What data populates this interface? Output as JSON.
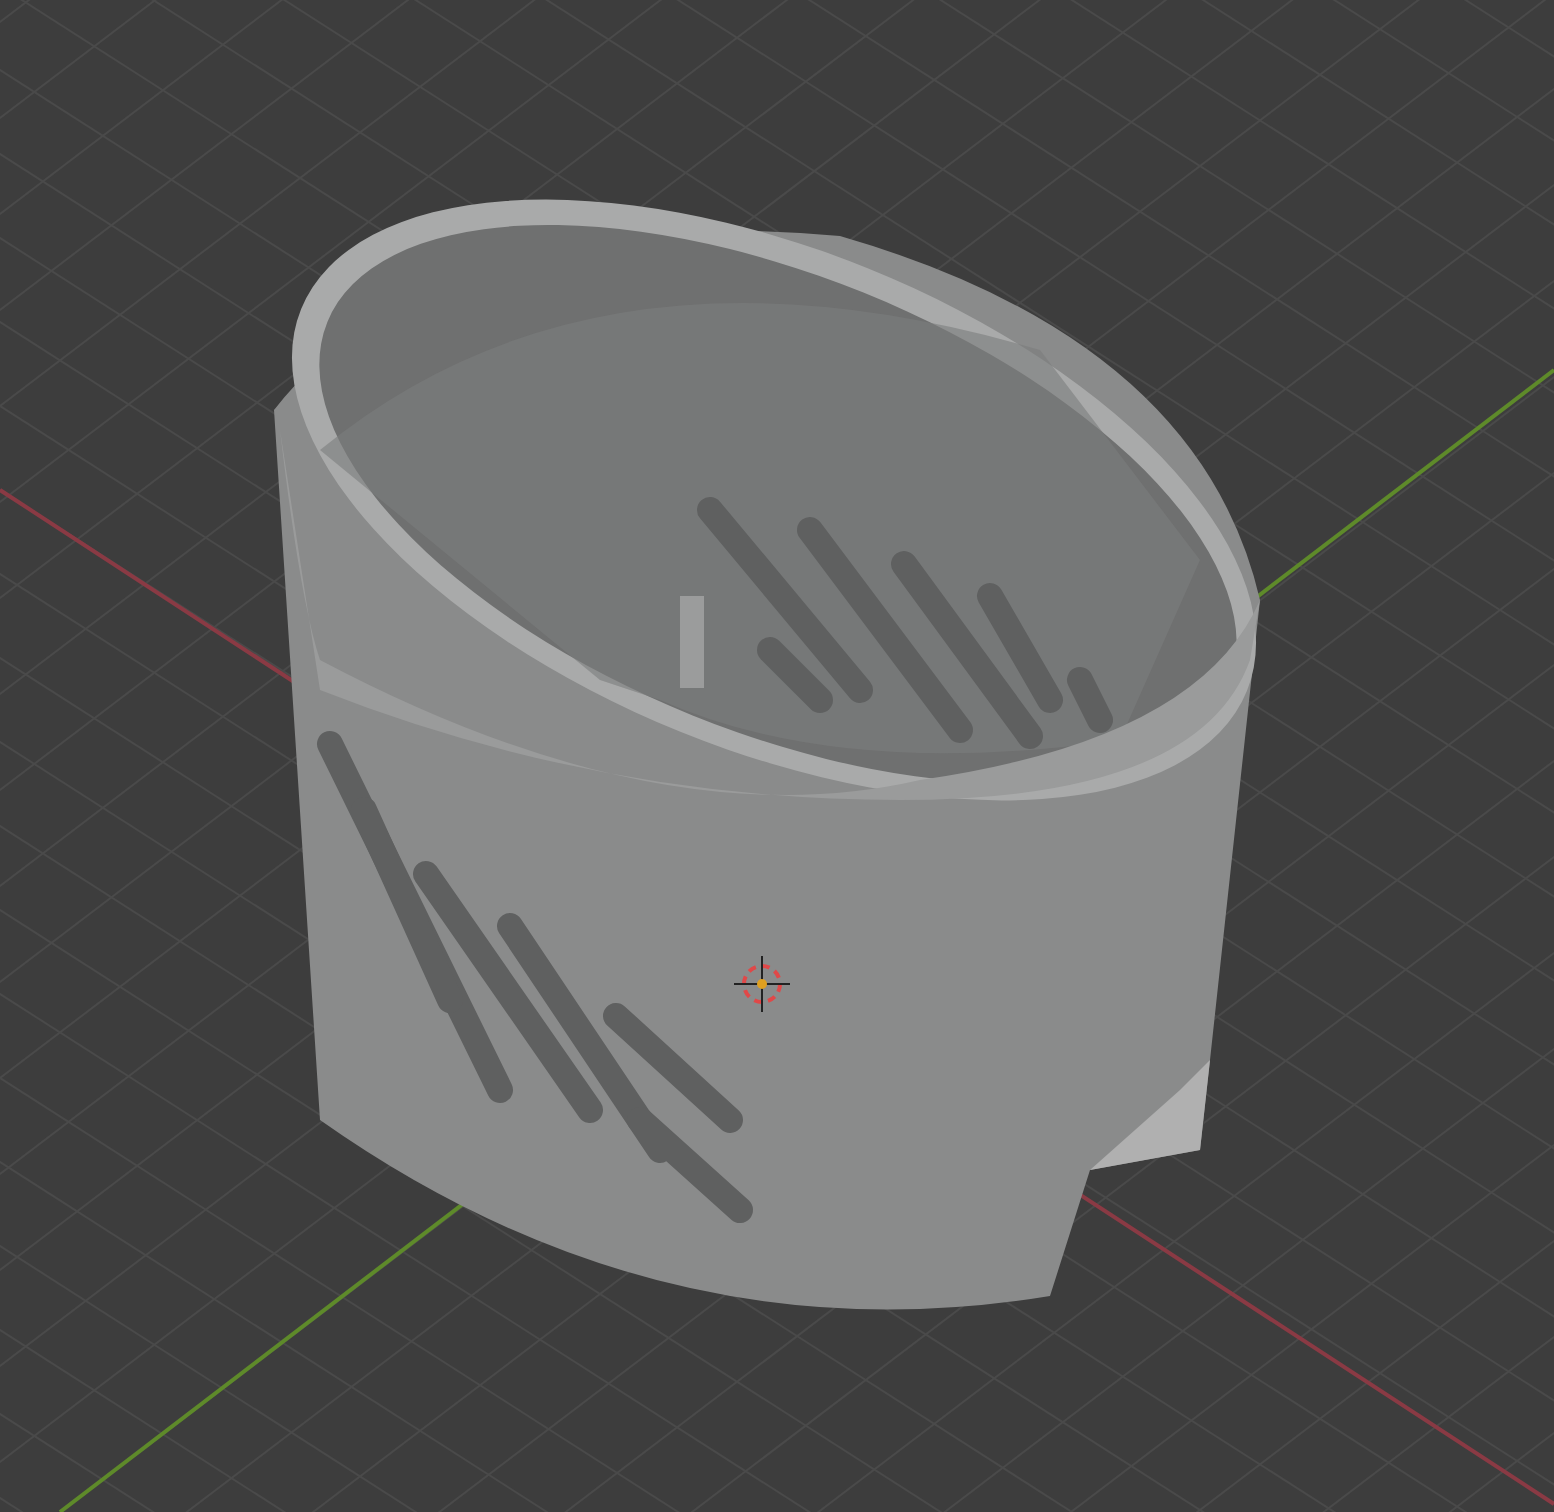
{
  "viewport": {
    "show_grid": true,
    "show_axes": true,
    "show_cursor": true,
    "show_model": true
  }
}
